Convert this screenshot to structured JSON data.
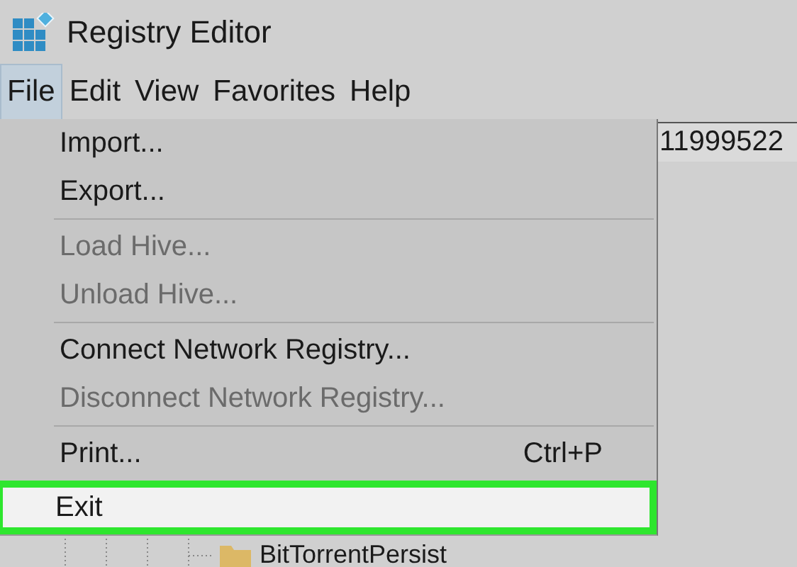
{
  "window": {
    "title": "Registry Editor"
  },
  "menu_bar": [
    {
      "label": "File",
      "selected": true
    },
    {
      "label": "Edit",
      "selected": false
    },
    {
      "label": "View",
      "selected": false
    },
    {
      "label": "Favorites",
      "selected": false
    },
    {
      "label": "Help",
      "selected": false
    }
  ],
  "file_menu": [
    {
      "kind": "item",
      "label": "Import...",
      "disabled": false,
      "highlighted": false
    },
    {
      "kind": "item",
      "label": "Export...",
      "disabled": false,
      "highlighted": false
    },
    {
      "kind": "separator"
    },
    {
      "kind": "item",
      "label": "Load Hive...",
      "disabled": true,
      "highlighted": false
    },
    {
      "kind": "item",
      "label": "Unload Hive...",
      "disabled": true,
      "highlighted": false
    },
    {
      "kind": "separator"
    },
    {
      "kind": "item",
      "label": "Connect Network Registry...",
      "disabled": false,
      "highlighted": false
    },
    {
      "kind": "item",
      "label": "Disconnect Network Registry...",
      "disabled": true,
      "highlighted": false
    },
    {
      "kind": "separator"
    },
    {
      "kind": "item",
      "label": "Print...",
      "shortcut": "Ctrl+P",
      "disabled": false,
      "highlighted": false
    },
    {
      "kind": "item",
      "label": "Exit",
      "disabled": false,
      "highlighted": true
    }
  ],
  "address_bar": {
    "value": "11999522"
  },
  "tree": {
    "items": [
      {
        "label": "BitTorrentPersist"
      }
    ]
  }
}
